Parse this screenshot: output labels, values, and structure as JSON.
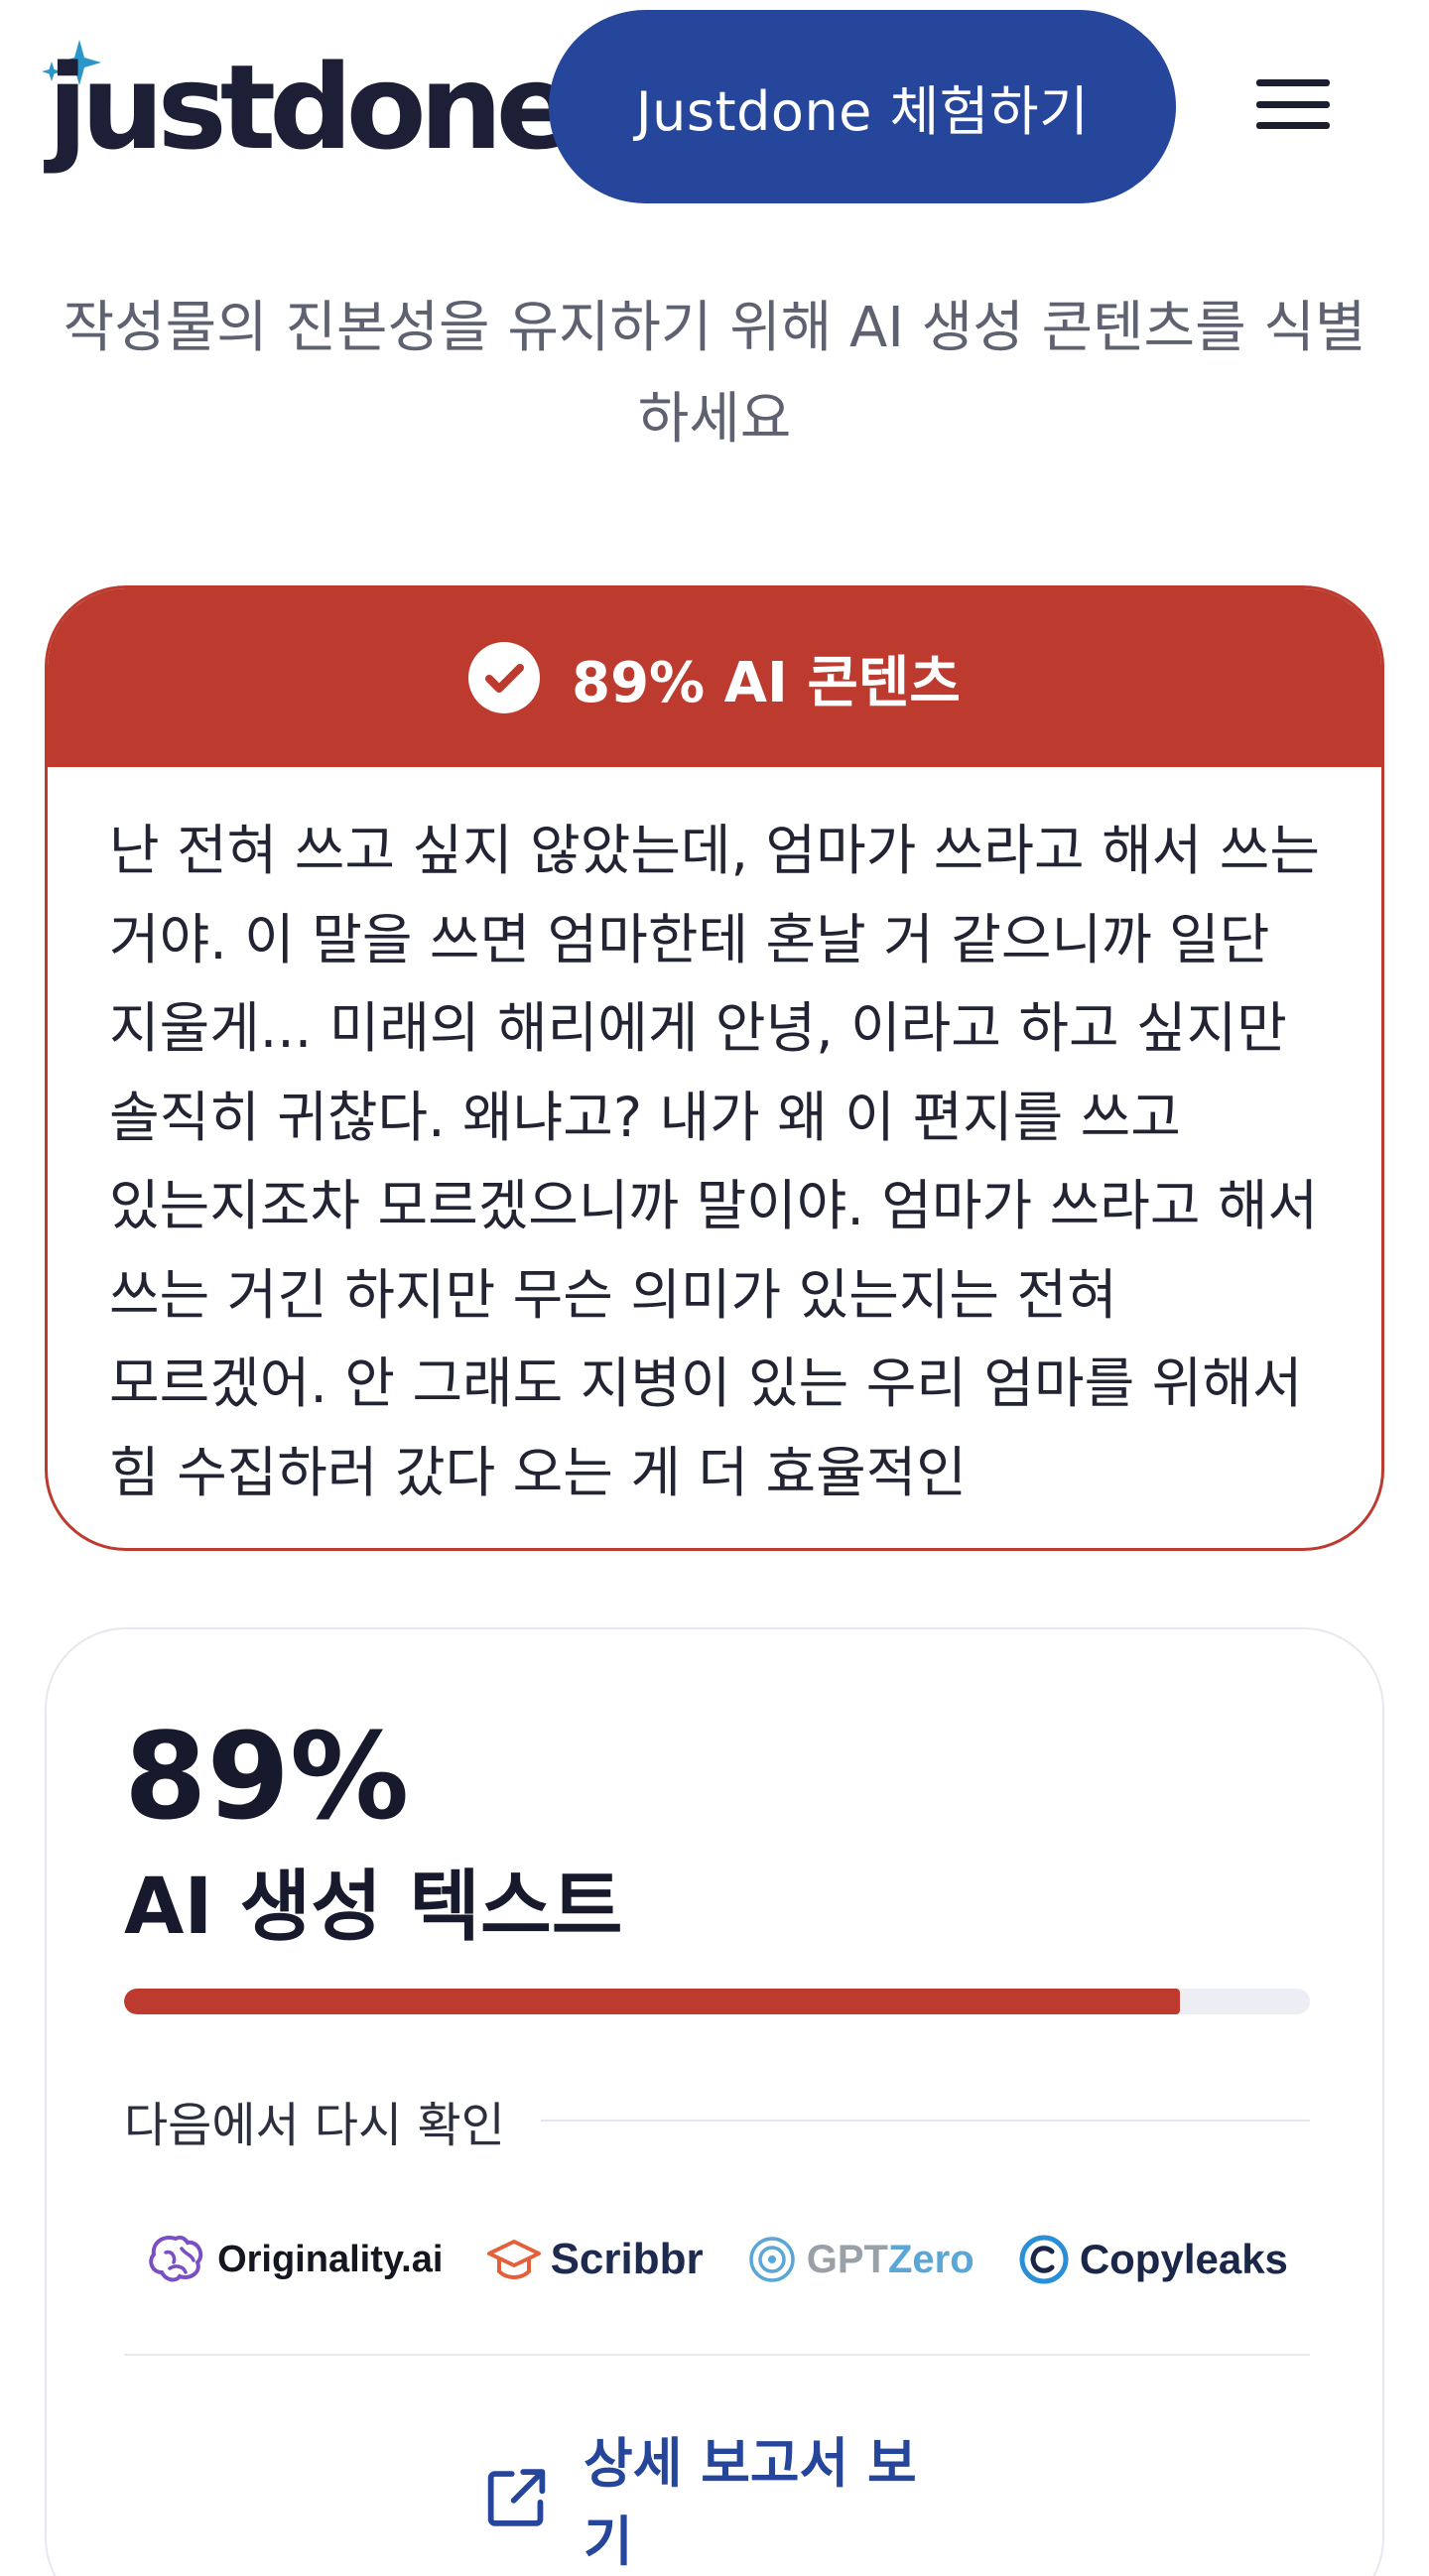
{
  "header": {
    "logo_text": "justdone",
    "cta_label": "Justdone 체험하기",
    "menu_icon": "hamburger-menu-icon"
  },
  "subtitle": "작성물의 진본성을 유지하기 위해 AI 생성 콘텐츠를 식별하세요",
  "result": {
    "banner_icon": "check-circle-icon",
    "banner_title": "89% AI 콘텐츠",
    "text": "난 전혀 쓰고 싶지 않았는데, 엄마가 쓰라고 해서 쓰는 거야. 이 말을 쓰면 엄마한테 혼날 거 같으니까 일단 지울게... 미래의 해리에게 안녕, 이라고 하고 싶지만 솔직히 귀찮다. 왜냐고? 내가 왜 이 편지를 쓰고 있는지조차 모르겠으니까 말이야. 엄마가 쓰라고 해서 쓰는 거긴 하지만 무슨 의미가 있는지는 전혀 모르겠어. 안 그래도 지병이 있는 우리 엄마를 위해서 힘 수집하러 갔다 오는 게 더 효율적인",
    "accent_color": "#bd3a2f"
  },
  "score": {
    "percent_text": "89%",
    "percent_value": 0.89,
    "label": "AI 생성 텍스트",
    "recheck_label": "다음에서 다시 확인",
    "brands": [
      {
        "name": "Originality.ai",
        "icon": "brain-icon"
      },
      {
        "name": "Scribbr",
        "icon": "graduation-cap-icon"
      },
      {
        "name_gpt": "GPT",
        "name_zero": "Zero",
        "icon": "target-icon"
      },
      {
        "name": "Copyleaks",
        "icon": "copyleaks-c-icon"
      }
    ],
    "report_label": "상세 보고서 보기",
    "report_icon": "external-link-icon"
  },
  "colors": {
    "primary": "#25469b",
    "danger": "#bd3a2f",
    "text": "#1b1e2e",
    "muted": "#5e6170"
  }
}
